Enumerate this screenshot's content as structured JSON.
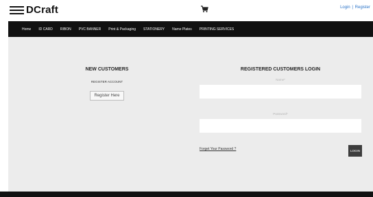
{
  "header": {
    "logo": "DCraft",
    "cart_icon": "cart-icon",
    "login": "Login",
    "separator": "|",
    "register": "Register"
  },
  "nav": {
    "items": [
      {
        "label": "Home"
      },
      {
        "label": "ID CARD"
      },
      {
        "label": "RIBON"
      },
      {
        "label": "PVC BANNER"
      },
      {
        "label": "Print & Packaging"
      },
      {
        "label": "STATIONERY"
      },
      {
        "label": "Name Plates"
      },
      {
        "label": "PRINTING SERVICES"
      }
    ]
  },
  "new_customers": {
    "title": "NEW CUSTOMERS",
    "subtitle": "REGISTER ACCOUNT",
    "button": "Register Here"
  },
  "login": {
    "title": "REGISTERED CUSTOMERS LOGIN",
    "name_label": "Name*",
    "name_value": "",
    "password_label": "Password*",
    "password_value": "",
    "forgot": "Forget Your Password ?",
    "button": "LOGIN"
  },
  "colors": {
    "nav_bg": "#111111",
    "main_bg": "#ececec",
    "link": "#2b74c9",
    "login_button": "#3d3d3d"
  }
}
